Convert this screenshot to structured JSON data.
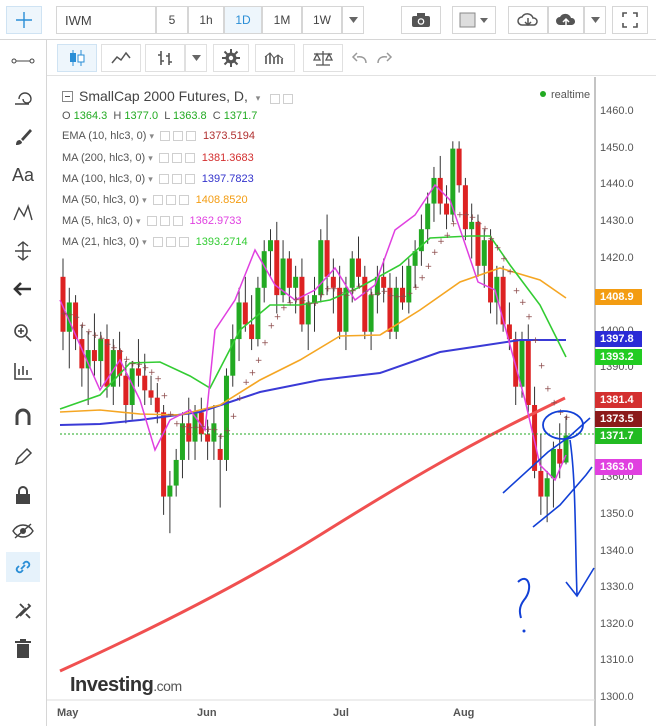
{
  "toolbar": {
    "symbol": "IWM",
    "intervals": [
      "5",
      "1h",
      "1D",
      "1M",
      "1W"
    ],
    "active_interval": "1D"
  },
  "legend": {
    "title": "SmallCap 2000 Futures, D,",
    "ohlc": {
      "O": "1364.3",
      "H": "1377.0",
      "L": "1363.8",
      "C": "1371.7"
    },
    "indicators": [
      {
        "label": "EMA (10, hlc3, 0)",
        "value": "1373.5194",
        "color": "#b03030"
      },
      {
        "label": "MA (200, hlc3, 0)",
        "value": "1381.3683",
        "color": "#d32f2f"
      },
      {
        "label": "MA (100, hlc3, 0)",
        "value": "1397.7823",
        "color": "#3333cc"
      },
      {
        "label": "MA (50, hlc3, 0)",
        "value": "1408.8520",
        "color": "#f39c12"
      },
      {
        "label": "MA (5, hlc3, 0)",
        "value": "1362.9733",
        "color": "#e040e0"
      },
      {
        "label": "MA (21, hlc3, 0)",
        "value": "1393.2714",
        "color": "#33cc33"
      }
    ],
    "realtime": "realtime"
  },
  "price_axis": {
    "ticks": [
      "1460.0",
      "1450.0",
      "1440.0",
      "1430.0",
      "1420.0",
      "1410.0",
      "1400.0",
      "1390.0",
      "1380.0",
      "1370.0",
      "1360.0",
      "1350.0",
      "1340.0",
      "1330.0",
      "1320.0",
      "1310.0",
      "1300.0"
    ],
    "tags": [
      {
        "label": "1408.9",
        "color": "#f39c12"
      },
      {
        "label": "1397.8",
        "color": "#2b2bd6"
      },
      {
        "label": "1393.2",
        "color": "#22cc22"
      },
      {
        "label": "1381.4",
        "color": "#d32f2f"
      },
      {
        "label": "1373.5",
        "color": "#8b1a1a"
      },
      {
        "label": "1371.7",
        "color": "#22bb22"
      },
      {
        "label": "1363.0",
        "color": "#e040e0"
      }
    ]
  },
  "time_axis": {
    "ticks": [
      "May",
      "Jun",
      "Jul",
      "Aug"
    ]
  },
  "watermark": {
    "brand": "Investing",
    "suffix": ".com"
  },
  "chart_data": {
    "type": "candlestick",
    "ylim": [
      1298,
      1466
    ],
    "candles": [
      [
        1415,
        1420,
        1395,
        1400
      ],
      [
        1400,
        1412,
        1390,
        1408
      ],
      [
        1408,
        1410,
        1395,
        1398
      ],
      [
        1398,
        1402,
        1385,
        1390
      ],
      [
        1390,
        1400,
        1380,
        1395
      ],
      [
        1395,
        1405,
        1388,
        1392
      ],
      [
        1392,
        1400,
        1385,
        1398
      ],
      [
        1398,
        1402,
        1382,
        1385
      ],
      [
        1385,
        1398,
        1380,
        1395
      ],
      [
        1395,
        1400,
        1385,
        1388
      ],
      [
        1388,
        1392,
        1375,
        1380
      ],
      [
        1380,
        1392,
        1376,
        1390
      ],
      [
        1390,
        1398,
        1385,
        1388
      ],
      [
        1388,
        1394,
        1380,
        1384
      ],
      [
        1384,
        1388,
        1380,
        1382
      ],
      [
        1382,
        1386,
        1375,
        1378
      ],
      [
        1378,
        1380,
        1350,
        1355
      ],
      [
        1355,
        1362,
        1345,
        1358
      ],
      [
        1358,
        1368,
        1355,
        1365
      ],
      [
        1365,
        1378,
        1360,
        1375
      ],
      [
        1375,
        1382,
        1365,
        1370
      ],
      [
        1370,
        1380,
        1365,
        1378
      ],
      [
        1378,
        1382,
        1370,
        1372
      ],
      [
        1372,
        1376,
        1365,
        1370
      ],
      [
        1370,
        1380,
        1365,
        1375
      ],
      [
        1368,
        1372,
        1352,
        1365
      ],
      [
        1365,
        1390,
        1362,
        1388
      ],
      [
        1388,
        1402,
        1385,
        1398
      ],
      [
        1398,
        1412,
        1392,
        1408
      ],
      [
        1408,
        1415,
        1400,
        1402
      ],
      [
        1402,
        1410,
        1395,
        1398
      ],
      [
        1398,
        1415,
        1396,
        1412
      ],
      [
        1412,
        1425,
        1408,
        1422
      ],
      [
        1422,
        1428,
        1415,
        1425
      ],
      [
        1425,
        1430,
        1405,
        1410
      ],
      [
        1410,
        1425,
        1408,
        1420
      ],
      [
        1420,
        1422,
        1408,
        1412
      ],
      [
        1412,
        1418,
        1405,
        1415
      ],
      [
        1415,
        1420,
        1400,
        1402
      ],
      [
        1402,
        1410,
        1395,
        1408
      ],
      [
        1408,
        1415,
        1400,
        1410
      ],
      [
        1410,
        1428,
        1408,
        1425
      ],
      [
        1425,
        1432,
        1410,
        1415
      ],
      [
        1415,
        1420,
        1405,
        1412
      ],
      [
        1412,
        1418,
        1398,
        1400
      ],
      [
        1400,
        1415,
        1395,
        1412
      ],
      [
        1412,
        1422,
        1408,
        1420
      ],
      [
        1420,
        1426,
        1412,
        1415
      ],
      [
        1415,
        1418,
        1398,
        1400
      ],
      [
        1400,
        1412,
        1395,
        1410
      ],
      [
        1410,
        1418,
        1405,
        1415
      ],
      [
        1415,
        1420,
        1408,
        1412
      ],
      [
        1412,
        1416,
        1398,
        1400
      ],
      [
        1400,
        1415,
        1398,
        1412
      ],
      [
        1412,
        1418,
        1406,
        1408
      ],
      [
        1408,
        1420,
        1405,
        1418
      ],
      [
        1418,
        1425,
        1412,
        1422
      ],
      [
        1422,
        1432,
        1418,
        1428
      ],
      [
        1428,
        1438,
        1424,
        1435
      ],
      [
        1435,
        1445,
        1430,
        1442
      ],
      [
        1442,
        1448,
        1432,
        1435
      ],
      [
        1435,
        1440,
        1428,
        1432
      ],
      [
        1432,
        1452,
        1430,
        1450
      ],
      [
        1450,
        1452,
        1438,
        1440
      ],
      [
        1440,
        1442,
        1425,
        1428
      ],
      [
        1428,
        1435,
        1420,
        1430
      ],
      [
        1430,
        1432,
        1415,
        1418
      ],
      [
        1418,
        1428,
        1412,
        1425
      ],
      [
        1425,
        1428,
        1405,
        1408
      ],
      [
        1408,
        1418,
        1402,
        1415
      ],
      [
        1415,
        1418,
        1400,
        1402
      ],
      [
        1402,
        1408,
        1395,
        1398
      ],
      [
        1398,
        1400,
        1380,
        1385
      ],
      [
        1385,
        1400,
        1382,
        1398
      ],
      [
        1398,
        1402,
        1378,
        1380
      ],
      [
        1380,
        1385,
        1360,
        1362
      ],
      [
        1362,
        1372,
        1350,
        1355
      ],
      [
        1355,
        1362,
        1348,
        1360
      ],
      [
        1360,
        1370,
        1352,
        1368
      ],
      [
        1368,
        1375,
        1360,
        1364
      ],
      [
        1364.3,
        1377.0,
        1363.8,
        1371.7
      ]
    ]
  }
}
